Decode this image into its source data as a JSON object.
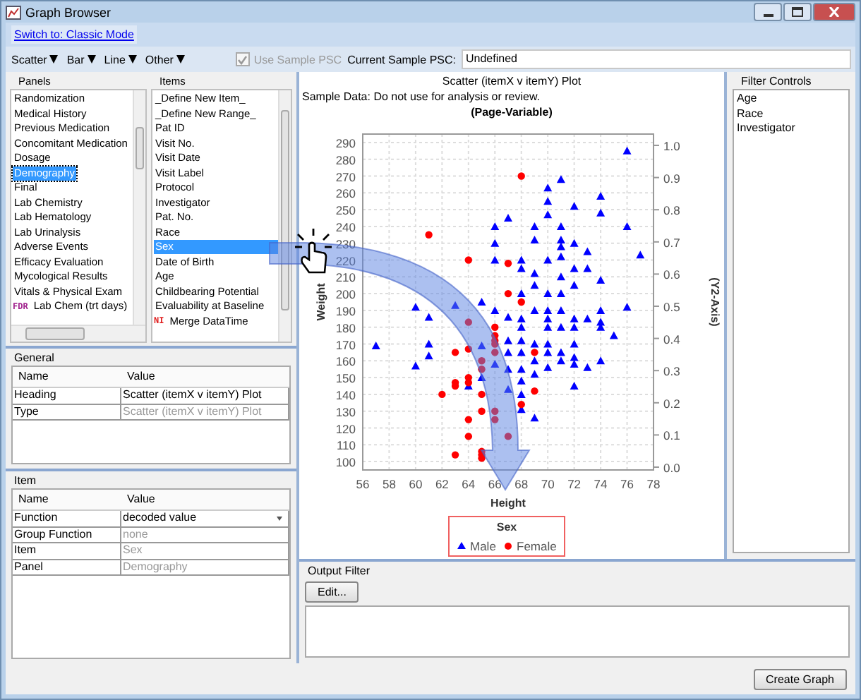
{
  "window": {
    "title": "Graph Browser"
  },
  "mode_link": "Switch to: Classic Mode",
  "menus": [
    "Scatter",
    "Bar",
    "Line",
    "Other"
  ],
  "sample_psc": {
    "label": "Use Sample PSC",
    "checked": true,
    "disabled": true
  },
  "current_psc": {
    "label": "Current Sample PSC:",
    "value": "Undefined"
  },
  "panels": {
    "heading": "Panels",
    "items": [
      {
        "label": "Randomization",
        "selected": false
      },
      {
        "label": "Medical History",
        "selected": false
      },
      {
        "label": "Previous Medication",
        "selected": false
      },
      {
        "label": "Concomitant Medication",
        "selected": false
      },
      {
        "label": "Dosage",
        "selected": false
      },
      {
        "label": "Demography",
        "selected": true
      },
      {
        "label": "Final",
        "selected": false
      },
      {
        "label": "Lab Chemistry",
        "selected": false
      },
      {
        "label": "Lab Hematology",
        "selected": false
      },
      {
        "label": "Lab Urinalysis",
        "selected": false
      },
      {
        "label": "Adverse Events",
        "selected": false
      },
      {
        "label": "Efficacy Evaluation",
        "selected": false
      },
      {
        "label": "Mycological Results",
        "selected": false
      },
      {
        "label": "Vitals & Physical Exam",
        "selected": false
      },
      {
        "label": "Lab Chem (trt days)",
        "selected": false,
        "badge": "FDR"
      }
    ]
  },
  "items": {
    "heading": "Items",
    "items": [
      {
        "label": "_Define New Item_",
        "selected": false
      },
      {
        "label": "_Define New Range_",
        "selected": false
      },
      {
        "label": "Pat ID",
        "selected": false
      },
      {
        "label": "Visit No.",
        "selected": false
      },
      {
        "label": "Visit Date",
        "selected": false
      },
      {
        "label": "Visit Label",
        "selected": false
      },
      {
        "label": "Protocol",
        "selected": false
      },
      {
        "label": "Investigator",
        "selected": false
      },
      {
        "label": "Pat. No.",
        "selected": false
      },
      {
        "label": "Race",
        "selected": false
      },
      {
        "label": "Sex",
        "selected": true
      },
      {
        "label": "Date of Birth",
        "selected": false
      },
      {
        "label": "Age",
        "selected": false
      },
      {
        "label": "Childbearing Potential",
        "selected": false
      },
      {
        "label": "Evaluability at Baseline",
        "selected": false
      },
      {
        "label": "Merge DataTime",
        "selected": false,
        "badge": "NI"
      }
    ]
  },
  "general": {
    "heading": "General",
    "columns": [
      "Name",
      "Value"
    ],
    "rows": [
      {
        "name": "Heading",
        "value": "Scatter (itemX v itemY) Plot",
        "disabled": false,
        "kind": "text"
      },
      {
        "name": "Type",
        "value": "Scatter (itemX v itemY) Plot",
        "disabled": true,
        "kind": "text"
      }
    ]
  },
  "item": {
    "heading": "Item",
    "columns": [
      "Name",
      "Value"
    ],
    "rows": [
      {
        "name": "Function",
        "value": "decoded value",
        "disabled": false,
        "kind": "dropdown"
      },
      {
        "name": "Group Function",
        "value": "none",
        "disabled": true,
        "kind": "text"
      },
      {
        "name": "Item",
        "value": "Sex",
        "disabled": true,
        "kind": "text"
      },
      {
        "name": "Panel",
        "value": "Demography",
        "disabled": true,
        "kind": "text"
      }
    ]
  },
  "plot": {
    "heading": "Scatter (itemX v itemY) Plot",
    "note": "Sample Data: Do not use for analysis or review.",
    "chart_data": {
      "type": "scatter",
      "title": "(Page-Variable)",
      "xlabel": "Height",
      "ylabel": "Weight",
      "xlim": [
        56,
        78
      ],
      "ylim": [
        95,
        295
      ],
      "xticks": [
        56,
        58,
        60,
        62,
        64,
        66,
        68,
        70,
        72,
        74,
        76,
        78
      ],
      "yticks": [
        100,
        110,
        120,
        130,
        140,
        150,
        160,
        170,
        180,
        190,
        200,
        210,
        220,
        230,
        240,
        250,
        260,
        270,
        280,
        290
      ],
      "y2label": "(Y2-Axis)",
      "y2ticks": [
        "0.0",
        "0.1",
        "0.2",
        "0.3",
        "0.4",
        "0.5",
        "0.6",
        "0.7",
        "0.8",
        "0.9",
        "1.0"
      ],
      "grid": true,
      "legend": true,
      "legend_title": "Sex",
      "series": [
        {
          "name": "Male",
          "color": "#0000ff",
          "marker": "triangle",
          "x": [
            76,
            71,
            70,
            70,
            72,
            74,
            70,
            74,
            67,
            66,
            69,
            71,
            76,
            66,
            69,
            71,
            72,
            71,
            73,
            77,
            71,
            66,
            68,
            70,
            72,
            73,
            68,
            71,
            69,
            74,
            69,
            72,
            71,
            68,
            70,
            60,
            63,
            65,
            66,
            69,
            70,
            71,
            74,
            76,
            61,
            67,
            68,
            70,
            72,
            73,
            74,
            68,
            70,
            71,
            72,
            74,
            75,
            57,
            61,
            65,
            67,
            68,
            69,
            70,
            72,
            61,
            60,
            66,
            67,
            68,
            70,
            71,
            72,
            73,
            74,
            69,
            71,
            65,
            67,
            68,
            69,
            70,
            72,
            64,
            68,
            72,
            67,
            68,
            68,
            69
          ],
          "values": [
            285,
            268,
            263,
            255,
            252,
            258,
            247,
            248,
            245,
            240,
            240,
            240,
            240,
            230,
            232,
            232,
            230,
            228,
            225,
            223,
            222,
            220,
            220,
            220,
            215,
            215,
            215,
            210,
            212,
            208,
            205,
            205,
            200,
            200,
            200,
            192,
            193,
            195,
            190,
            190,
            190,
            190,
            190,
            192,
            186,
            186,
            185,
            185,
            185,
            185,
            183,
            180,
            180,
            180,
            180,
            180,
            175,
            169,
            170,
            169,
            172,
            172,
            170,
            170,
            170,
            163,
            157,
            158,
            165,
            165,
            165,
            165,
            162,
            156,
            160,
            160,
            160,
            150,
            155,
            155,
            152,
            156,
            158,
            145,
            148,
            145,
            143,
            140,
            131,
            126
          ]
        },
        {
          "name": "Female",
          "color": "#ff0000",
          "marker": "circle",
          "x": [
            68,
            61,
            64,
            67,
            67,
            68,
            64,
            66,
            66,
            66,
            66,
            64,
            63,
            65,
            65,
            66,
            69,
            64,
            64,
            63,
            63,
            62,
            65,
            69,
            68,
            65,
            66,
            64,
            66,
            64,
            67,
            63,
            65,
            65,
            65
          ],
          "values": [
            270,
            235,
            220,
            218,
            200,
            195,
            183,
            180,
            175,
            172,
            170,
            167,
            165,
            160,
            155,
            165,
            165,
            150,
            147,
            147,
            145,
            140,
            140,
            142,
            134,
            130,
            130,
            125,
            125,
            115,
            115,
            104,
            106,
            104,
            102
          ]
        }
      ]
    }
  },
  "filter_controls": {
    "heading": "Filter Controls",
    "items": [
      "Age",
      "Race",
      "Investigator"
    ]
  },
  "output_filter": {
    "heading": "Output Filter",
    "button": "Edit..."
  },
  "create_button": "Create Graph"
}
